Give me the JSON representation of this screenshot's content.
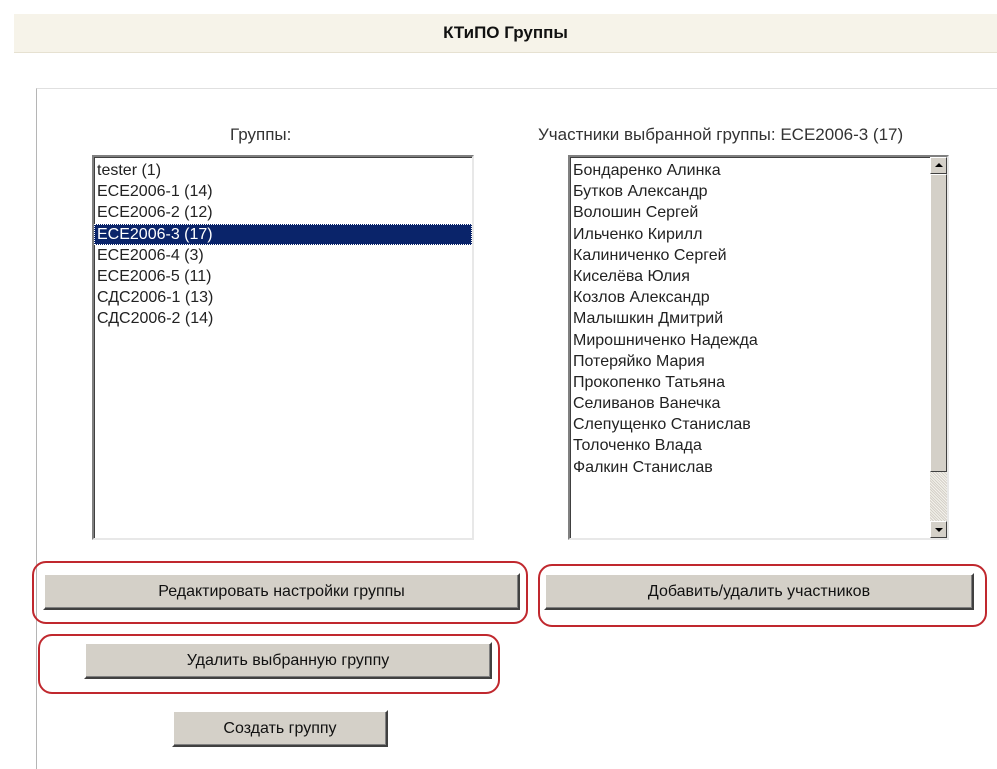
{
  "title": "КТиПО Группы",
  "groups_label": "Группы:",
  "members_label": "Участники выбранной группы: ECE2006-3 (17)",
  "groups": [
    {
      "label": "tester (1)",
      "selected": false
    },
    {
      "label": "ECE2006-1 (14)",
      "selected": false
    },
    {
      "label": "ECE2006-2 (12)",
      "selected": false
    },
    {
      "label": "ECE2006-3 (17)",
      "selected": true
    },
    {
      "label": "ECE2006-4 (3)",
      "selected": false
    },
    {
      "label": "ECE2006-5 (11)",
      "selected": false
    },
    {
      "label": "СДС2006-1 (13)",
      "selected": false
    },
    {
      "label": "СДС2006-2 (14)",
      "selected": false
    }
  ],
  "members": [
    "Бондаренко Алинка",
    "Бутков Александр",
    "Волошин Сергей",
    "Ильченко Кирилл",
    "Калиниченко Сергей",
    "Киселёва Юлия",
    "Козлов Александр",
    "Малышкин Дмитрий",
    "Мирошниченко Надежда",
    "Потеряйко Мария",
    "Прокопенко Татьяна",
    "Селиванов Ванечка",
    "Слепущенко Станислав",
    "Толоченко Влада",
    "Фалкин Станислав"
  ],
  "buttons": {
    "edit_group": "Редактировать настройки группы",
    "add_remove_members": "Добавить/удалить участников",
    "delete_group": "Удалить выбранную группу",
    "create_group": "Создать группу"
  },
  "colors": {
    "selection": "#0a246a",
    "highlight": "#c0282e",
    "title_bar": "#f6f3e9",
    "button_face": "#d4d0c8"
  },
  "icons": {
    "scroll_up": "triangle-up-icon",
    "scroll_down": "triangle-down-icon"
  }
}
